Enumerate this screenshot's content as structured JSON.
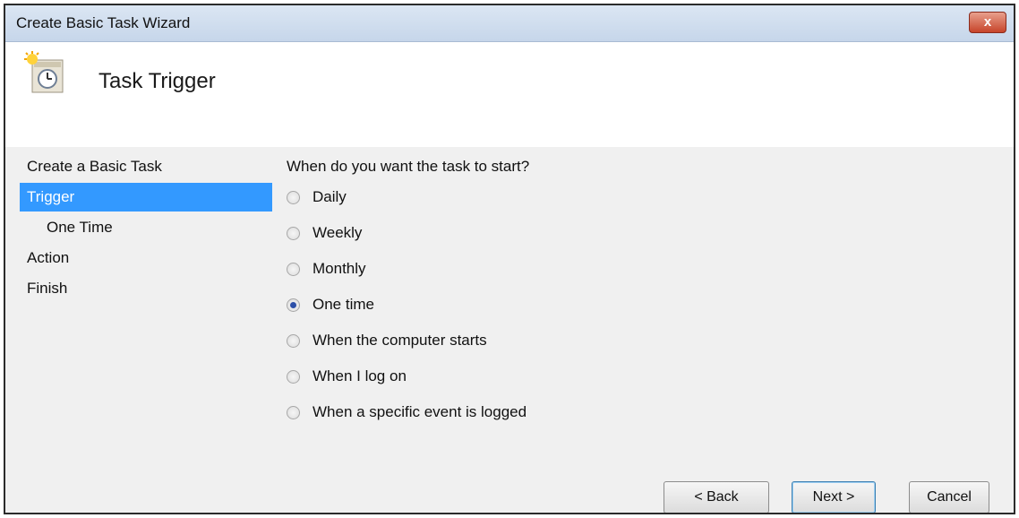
{
  "window": {
    "title": "Create Basic Task Wizard",
    "close_label": "x"
  },
  "header": {
    "title": "Task Trigger",
    "icon": "scheduled-task-clock-icon"
  },
  "sidebar": {
    "items": [
      {
        "label": "Create a Basic Task"
      },
      {
        "label": "Trigger"
      },
      {
        "label": "One Time"
      },
      {
        "label": "Action"
      },
      {
        "label": "Finish"
      }
    ],
    "active_index": 1
  },
  "main": {
    "question": "When do you want the task to start?",
    "options": [
      {
        "label": "Daily",
        "checked": false
      },
      {
        "label": "Weekly",
        "checked": false
      },
      {
        "label": "Monthly",
        "checked": false
      },
      {
        "label": "One time",
        "checked": true
      },
      {
        "label": "When the computer starts",
        "checked": false
      },
      {
        "label": "When I log on",
        "checked": false
      },
      {
        "label": "When a specific event is logged",
        "checked": false
      }
    ]
  },
  "buttons": {
    "back": "< Back",
    "next": "Next >",
    "cancel": "Cancel"
  },
  "colors": {
    "selection": "#3399ff",
    "dialog_bg": "#f0f0f0",
    "close_red": "#c7442a"
  }
}
